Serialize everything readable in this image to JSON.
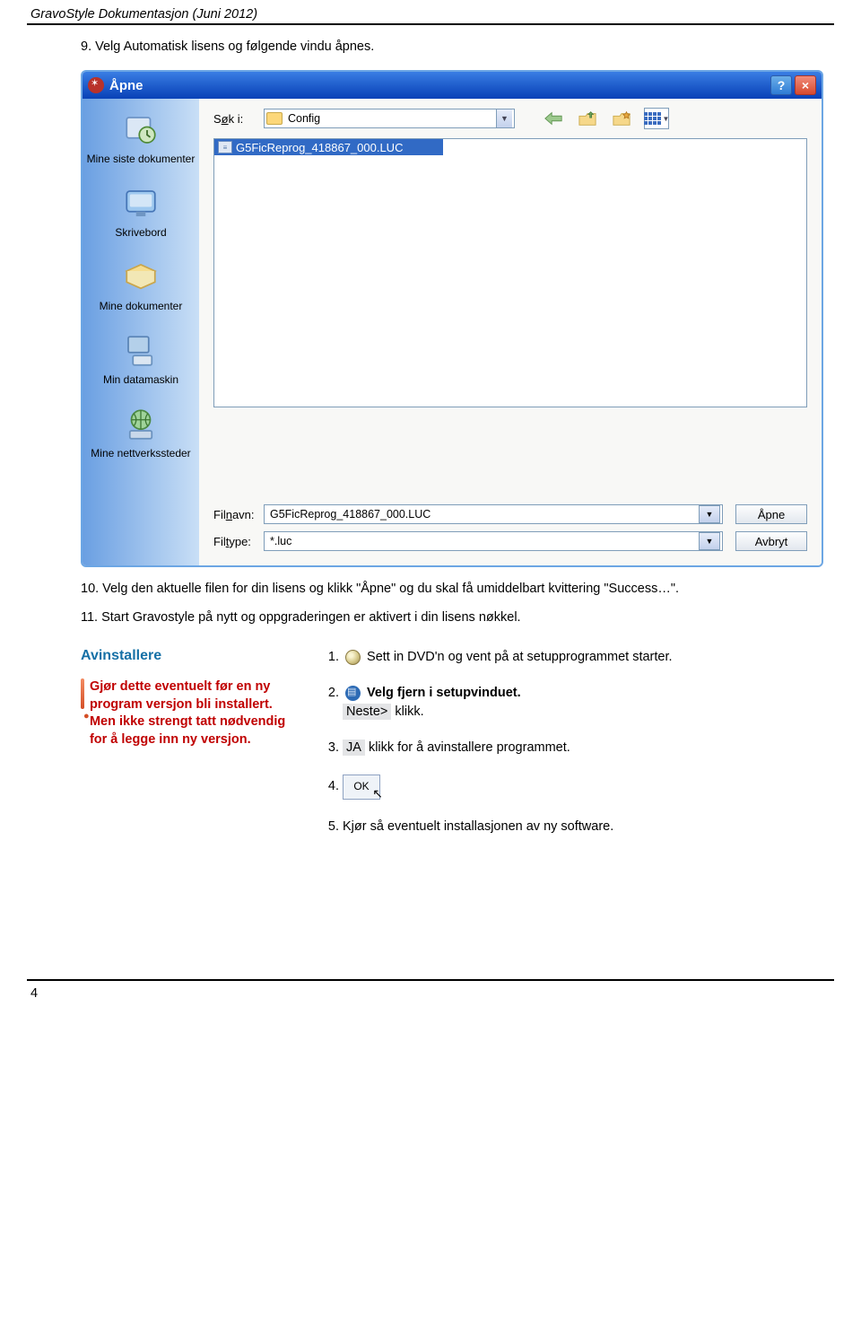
{
  "header": {
    "title": "GravoStyle Dokumentasjon (Juni 2012)"
  },
  "intro": {
    "step9_prefix": "9.",
    "step9_text": "Velg Automatisk lisens og følgende vindu åpnes."
  },
  "dialog": {
    "title": "Åpne",
    "help_char": "?",
    "close_char": "×",
    "search_label": "Søk i:",
    "search_key": "ø",
    "folder_name": "Config",
    "file_item": "G5FicReprog_418867_000.LUC",
    "sidebar": [
      {
        "label": "Mine siste dokumenter"
      },
      {
        "label": "Skrivebord"
      },
      {
        "label": "Mine dokumenter"
      },
      {
        "label": "Min datamaskin"
      },
      {
        "label": "Mine nettverkssteder"
      }
    ],
    "filename_label": "Filnavn:",
    "filename_value": "G5FicReprog_418867_000.LUC",
    "filename_key": "n",
    "filetype_label": "Filtype:",
    "filetype_value": "*.luc",
    "filetype_key": "t",
    "open_btn": "Åpne",
    "cancel_btn": "Avbryt"
  },
  "after_dialog": {
    "step10": "10. Velg den aktuelle filen for din lisens og klikk \"Åpne\" og du skal få umiddelbart kvittering \"Success…\".",
    "step11": "11. Start Gravostyle på nytt og oppgraderingen er aktivert i din lisens nøkkel."
  },
  "uninstall": {
    "heading": "Avinstallere",
    "warning": "Gjør dette eventuelt før en ny program versjon bli installert. Men ikke strengt tatt nødvendig for å legge inn ny versjon.",
    "items": {
      "s1_a": "Sett in DVD'n og ",
      "s1_b": "vent på at setupprogrammet starter.",
      "s2_label": "Velg fjern i setupvinduet.",
      "s2_next": "Neste>",
      "s2_rest": " klikk.",
      "s3_ja": "JA",
      "s3_rest": " klikk for å avinstallere programmet.",
      "s4_ok": "OK",
      "s5": "Kjør så eventuelt installasjonen av ny software."
    }
  },
  "page_number": "4"
}
